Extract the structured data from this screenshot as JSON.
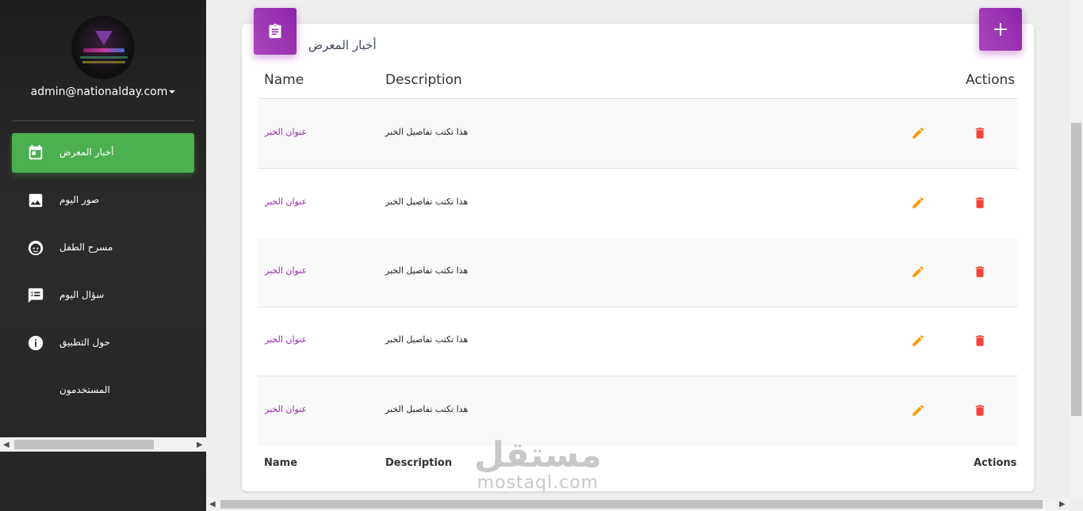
{
  "sidebar": {
    "user_email": "admin@nationalday.com",
    "items": [
      {
        "label": "أخبار المعرض",
        "icon": "calendar-icon",
        "active": true
      },
      {
        "label": "صور اليوم",
        "icon": "image-icon",
        "active": false
      },
      {
        "label": "مسرح الطفل",
        "icon": "child-face-icon",
        "active": false
      },
      {
        "label": "سؤال اليوم",
        "icon": "chat-question-icon",
        "active": false
      },
      {
        "label": "حول التطبيق",
        "icon": "info-icon",
        "active": false
      },
      {
        "label": "المستخدمون",
        "icon": "",
        "active": false
      }
    ],
    "accent_color": "#4caf50"
  },
  "card": {
    "title": "أخبار المعرض",
    "header_icon": "clipboard-icon",
    "add_icon": "plus-icon",
    "accent_color": "#9c27b0",
    "columns": {
      "name": "Name",
      "description": "Description",
      "actions": "Actions"
    },
    "rows": [
      {
        "name": "عنوان الخبر",
        "description": "هذا تكتب تفاصيل الخبر"
      },
      {
        "name": "عنوان الخبر",
        "description": "هذا تكتب تفاصيل الخبر"
      },
      {
        "name": "عنوان الخبر",
        "description": "هذا تكتب تفاصيل الخبر"
      },
      {
        "name": "عنوان الخبر",
        "description": "هذا تكتب تفاصيل الخبر"
      },
      {
        "name": "عنوان الخبر",
        "description": "هذا تكتب تفاصيل الخبر"
      }
    ],
    "edit_color": "#ff9800",
    "delete_color": "#f44336"
  },
  "watermark": {
    "arabic": "مستقل",
    "latin": "mostaql.com"
  }
}
